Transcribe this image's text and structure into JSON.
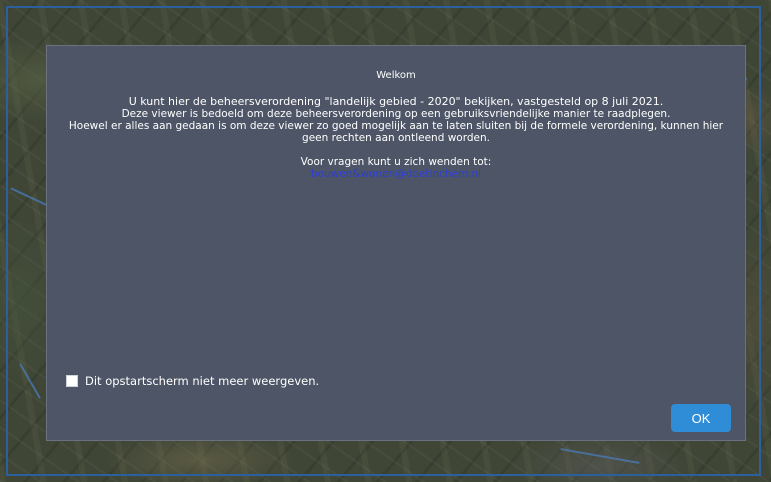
{
  "dialog": {
    "title": "Welkom",
    "intro_lines": [
      "U kunt hier de beheersverordening \"landelijk gebied - 2020\" bekijken, vastgesteld op 8 juli 2021.",
      "Deze viewer is bedoeld om deze beheersverordening op een gebruiksvriendelijke manier te raadplegen.",
      "Hoewel er alles aan gedaan is om deze viewer zo goed mogelijk aan te laten sluiten bij de formele verordening, kunnen hier geen rechten aan ontleend worden."
    ],
    "questions_label": "Voor vragen kunt u zich wenden tot:",
    "email": "bouwen&wonen@doetinchem.nl",
    "checkbox_label": "Dit opstartscherm niet meer weergeven.",
    "checkbox_checked": false,
    "ok_label": "OK"
  },
  "colors": {
    "dialog_background": "#4d5566",
    "ok_button": "#2f8cd6",
    "link": "#2d3fd6",
    "map_frame": "#2c5f9e"
  },
  "background": {
    "type": "aerial map imagery"
  }
}
